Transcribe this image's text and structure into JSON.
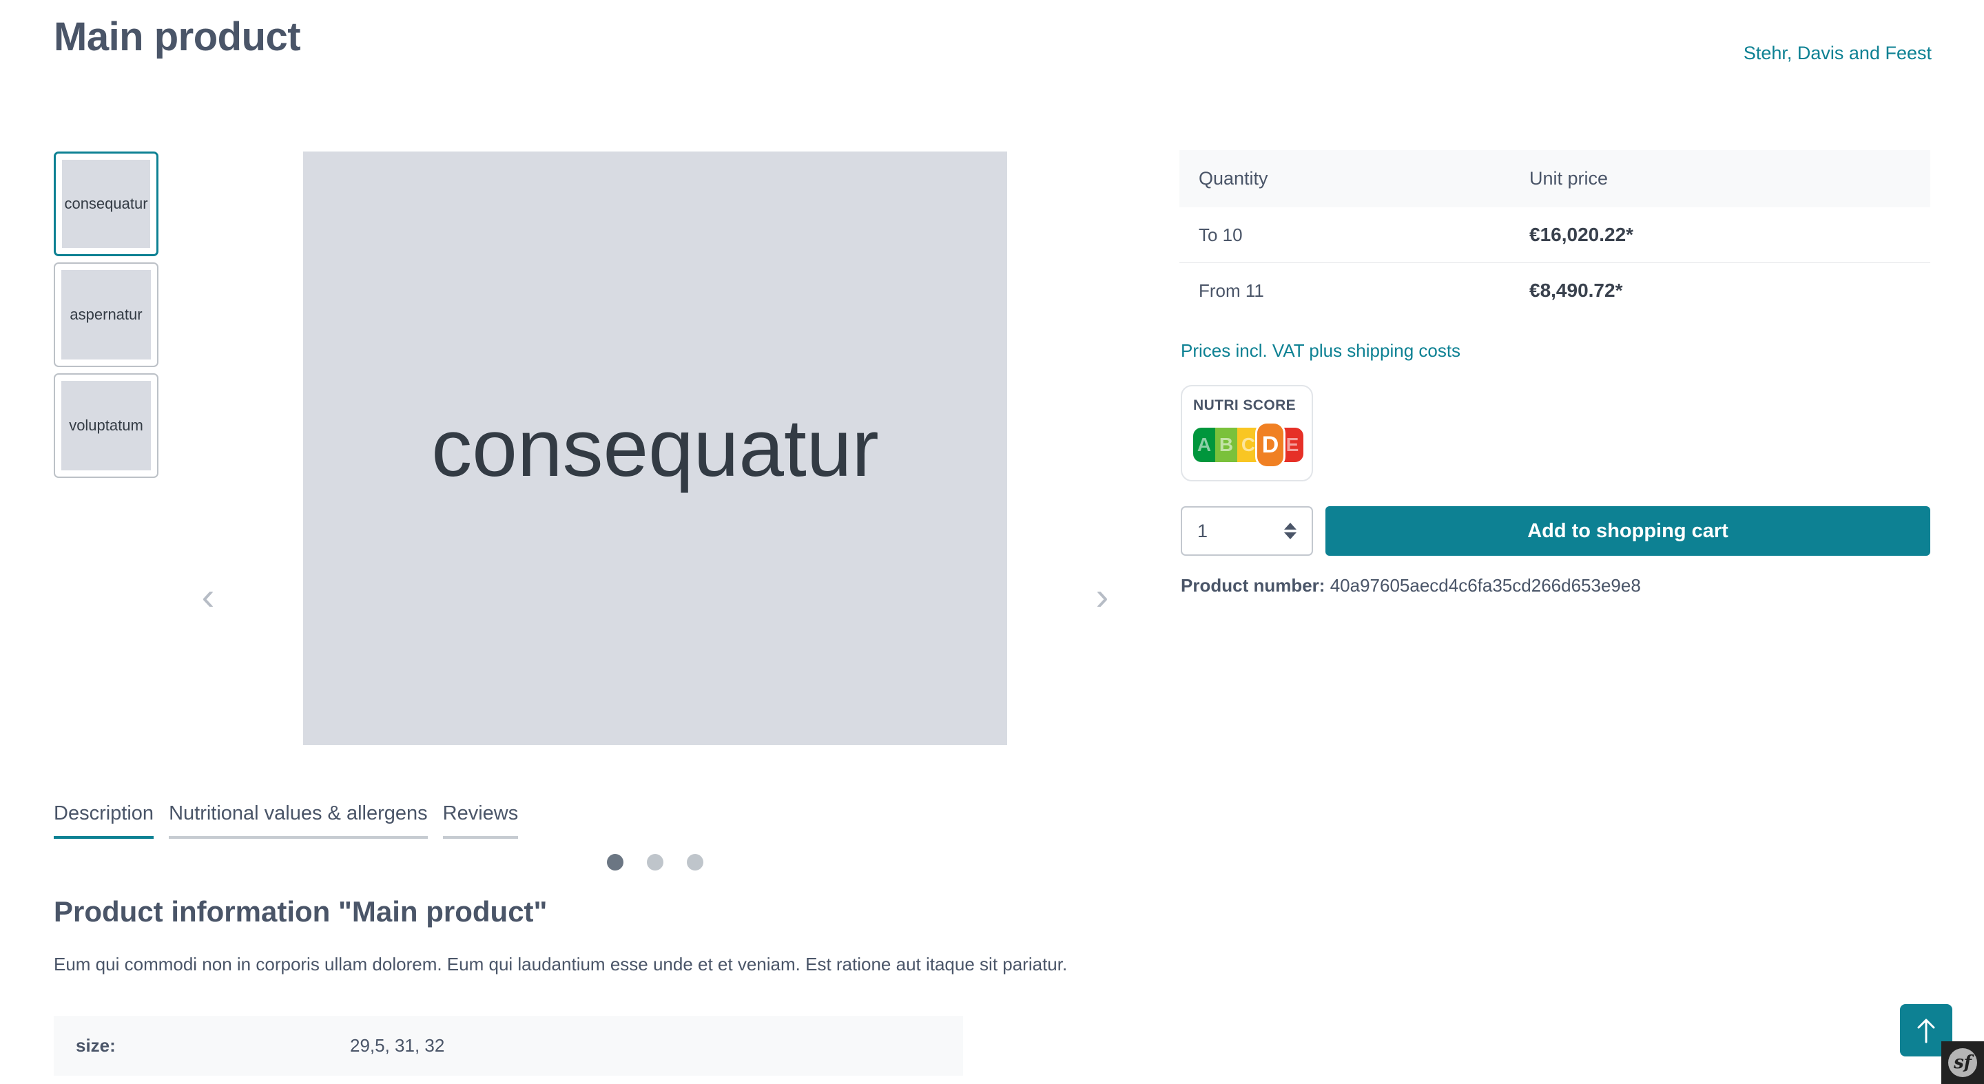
{
  "header": {
    "title": "Main product",
    "vendor": "Stehr, Davis and Feest"
  },
  "gallery": {
    "thumbnails": [
      {
        "label": "consequatur",
        "active": true
      },
      {
        "label": "aspernatur",
        "active": false
      },
      {
        "label": "voluptatum",
        "active": false
      }
    ],
    "current_image_label": "consequatur",
    "prev_icon": "chevron-left-icon",
    "next_icon": "chevron-right-icon",
    "prev_glyph": "‹",
    "next_glyph": "›",
    "dots": [
      true,
      false,
      false
    ]
  },
  "buybox": {
    "price_table": {
      "columns": [
        "Quantity",
        "Unit price"
      ],
      "rows": [
        {
          "quantity": "To 10",
          "price": "€16,020.22*"
        },
        {
          "quantity": "From 11",
          "price": "€8,490.72*"
        }
      ]
    },
    "vat_note": "Prices incl. VAT plus shipping costs",
    "nutri_score": {
      "title": "NUTRI SCORE",
      "grades": [
        "A",
        "B",
        "C",
        "D",
        "E"
      ],
      "active_grade": "D",
      "colors": [
        "#00963c",
        "#7ac13b",
        "#f9c623",
        "#f08023",
        "#e63027"
      ]
    },
    "quantity_value": "1",
    "add_to_cart_label": "Add to shopping cart",
    "product_number_label": "Product number:",
    "product_number_value": "40a97605aecd4c6fa35cd266d653e9e8"
  },
  "tabs": [
    {
      "label": "Description",
      "active": true
    },
    {
      "label": "Nutritional values & allergens",
      "active": false
    },
    {
      "label": "Reviews",
      "active": false
    }
  ],
  "description": {
    "heading": "Product information \"Main product\"",
    "body": "Eum qui commodi non in corporis ullam dolorem. Eum qui laudantium esse unde et et veniam. Est ratione aut itaque sit pariatur.",
    "properties": [
      {
        "key": "size:",
        "value": "29,5, 31, 32"
      }
    ]
  },
  "floating": {
    "scroll_top_icon": "arrow-up-icon",
    "symfony_badge_text": "sf"
  },
  "theme": {
    "accent": "#0d8193",
    "text": "#4a5568",
    "placeholder_bg": "#d8dbe2",
    "table_header_bg": "#f8f9fa"
  }
}
